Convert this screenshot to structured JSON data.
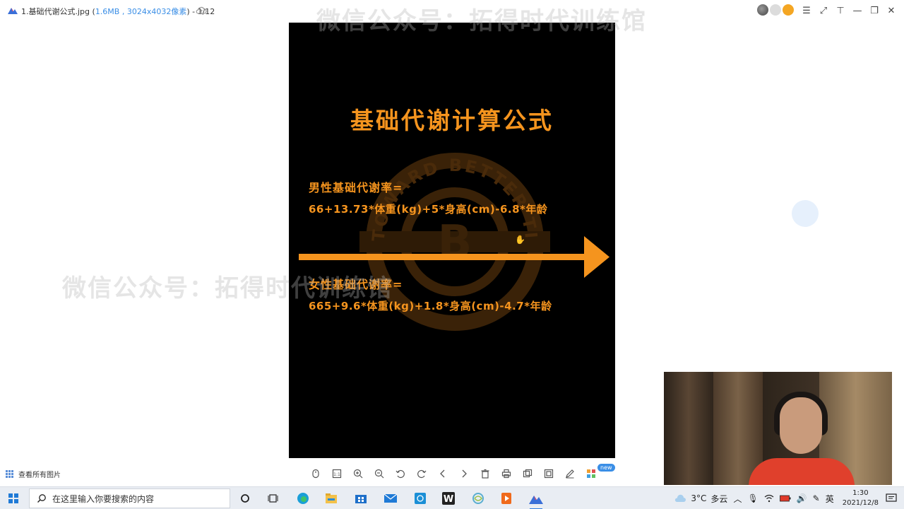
{
  "window": {
    "title_prefix": "1.基础代谢公式.jpg (",
    "file_size": "1.6MB",
    "separator": " , ",
    "dimensions": "3024x4032像素",
    "title_suffix": ") - 1/12"
  },
  "watermark": {
    "text": "微信公众号：拓得时代训练馆"
  },
  "image": {
    "title": "基础代谢计算公式",
    "logo_text": "TOWARD BETTER TIME",
    "male_label": "男性基础代谢率=",
    "male_formula": "66+13.73*体重(kg)+5*身高(cm)-6.8*年龄",
    "female_label": "女性基础代谢率=",
    "female_formula": "665+9.6*体重(kg)+1.8*身高(cm)-4.7*年龄",
    "accent_color": "#f5941e"
  },
  "viewer": {
    "view_all_label": "查看所有图片",
    "new_badge": "new",
    "toolbar_icons": [
      "bookmark-icon",
      "actual-size-icon",
      "zoom-in-icon",
      "zoom-out-icon",
      "rotate-left-icon",
      "rotate-right-icon",
      "previous-icon",
      "next-icon",
      "delete-icon",
      "print-icon",
      "copy-icon",
      "compare-icon",
      "edit-icon",
      "apps-icon"
    ]
  },
  "taskbar": {
    "search_placeholder": "在这里输入你要搜索的内容",
    "weather_temp": "3°C",
    "weather_desc": "多云",
    "ime": "英",
    "time": "1:30",
    "date": "2021/12/8"
  }
}
